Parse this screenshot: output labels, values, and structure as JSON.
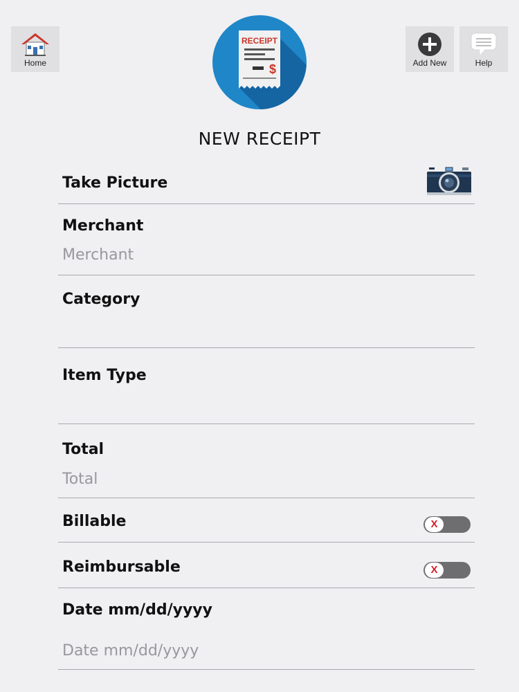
{
  "header": {
    "home_label": "Home",
    "add_new_label": "Add New",
    "help_label": "Help",
    "logo": {
      "text": "RECEIPT",
      "symbol": "$",
      "circle_color": "#1f86c8"
    }
  },
  "page_title": "NEW RECEIPT",
  "form": {
    "take_picture": {
      "label": "Take Picture",
      "icon": "camera-icon"
    },
    "merchant": {
      "label": "Merchant",
      "placeholder": "Merchant",
      "value": ""
    },
    "category": {
      "label": "Category",
      "value": ""
    },
    "item_type": {
      "label": "Item Type",
      "value": ""
    },
    "total": {
      "label": "Total",
      "placeholder": "Total",
      "value": ""
    },
    "billable": {
      "label": "Billable",
      "toggle_state": "off",
      "toggle_symbol": "X"
    },
    "reimbursable": {
      "label": "Reimbursable",
      "toggle_state": "off",
      "toggle_symbol": "X"
    },
    "date": {
      "label": "Date mm/dd/yyyy",
      "placeholder": "Date mm/dd/yyyy",
      "value": ""
    }
  },
  "colors": {
    "background": "#f0eff2",
    "button_bg": "#e0dfe2",
    "divider": "#a9a9ad",
    "toggle_track": "#6e6e71",
    "toggle_x": "#d0212a"
  }
}
